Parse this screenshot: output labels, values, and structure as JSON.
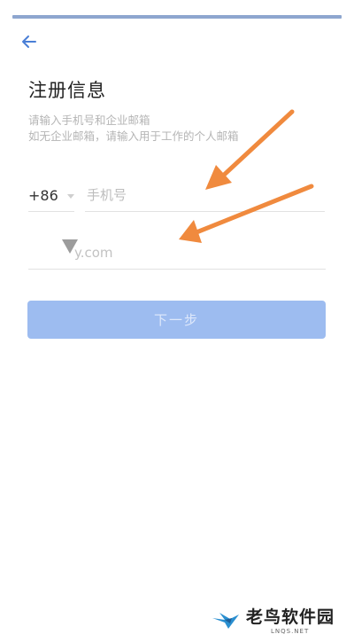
{
  "header": {
    "back_icon": "arrow-left-icon",
    "title": "注册信息"
  },
  "hints": {
    "line1": "请输入手机号和企业邮箱",
    "line2": "如无企业邮箱，请输入用于工作的个人邮箱"
  },
  "form": {
    "country_code": "+86",
    "phone_placeholder": "手机号",
    "email_placeholder": "y.com",
    "next_label": "下一步"
  },
  "watermark": {
    "brand": "老鸟软件园",
    "url": "LNQS.NET"
  },
  "colors": {
    "accent": "#9dbcf0",
    "arrow": "#f08a3e",
    "back_icon": "#4a7fd6"
  }
}
